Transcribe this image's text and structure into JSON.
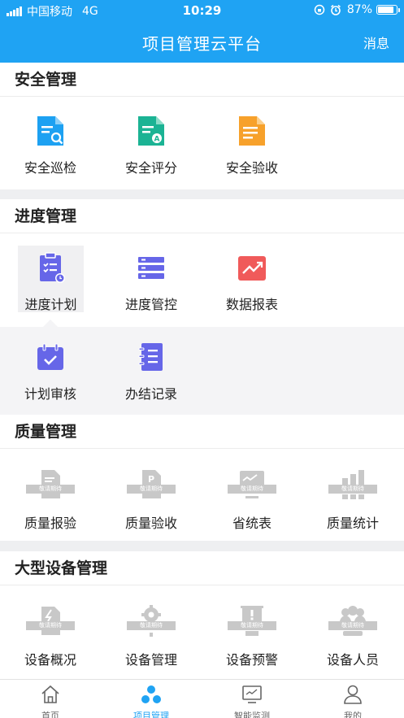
{
  "status_bar": {
    "carrier": "中国移动",
    "network": "4G",
    "time": "10:29",
    "battery": "87%",
    "battery_level": 0.87
  },
  "nav": {
    "title": "项目管理云平台",
    "message": "消息"
  },
  "sections": {
    "safety": {
      "title": "安全管理",
      "items": [
        {
          "label": "安全巡检",
          "icon": "document-search-icon",
          "color": "#1da1f2"
        },
        {
          "label": "安全评分",
          "icon": "document-grade-icon",
          "color": "#1bb394"
        },
        {
          "label": "安全验收",
          "icon": "document-list-icon",
          "color": "#f7a12b"
        }
      ]
    },
    "progress": {
      "title": "进度管理",
      "items": [
        {
          "label": "进度计划",
          "icon": "clipboard-plan-icon",
          "color": "#6666e8"
        },
        {
          "label": "进度管控",
          "icon": "layers-icon",
          "color": "#6666e8"
        },
        {
          "label": "数据报表",
          "icon": "trend-chart-icon",
          "color": "#f05a5a"
        }
      ],
      "sub_items": [
        {
          "label": "计划审核",
          "icon": "calendar-check-icon",
          "color": "#6666e8"
        },
        {
          "label": "办结记录",
          "icon": "notebook-icon",
          "color": "#6666e8"
        }
      ]
    },
    "quality": {
      "title": "质量管理",
      "items": [
        {
          "label": "质量报验",
          "ribbon": "敬请期待",
          "icon": "document-icon"
        },
        {
          "label": "质量验收",
          "ribbon": "敬请期待",
          "icon": "parking-document-icon"
        },
        {
          "label": "省统表",
          "ribbon": "敬请期待",
          "icon": "monitor-chart-icon"
        },
        {
          "label": "质量统计",
          "ribbon": "敬请期待",
          "icon": "bar-chart-icon"
        }
      ]
    },
    "equipment": {
      "title": "大型设备管理",
      "items": [
        {
          "label": "设备概况",
          "ribbon": "敬请期待",
          "icon": "lightning-document-icon"
        },
        {
          "label": "设备管理",
          "ribbon": "敬请期待",
          "icon": "gear-icon"
        },
        {
          "label": "设备预警",
          "ribbon": "敬请期待",
          "icon": "warning-board-icon"
        },
        {
          "label": "设备人员",
          "ribbon": "敬请期待",
          "icon": "people-icon"
        }
      ]
    }
  },
  "tabs": [
    {
      "label": "首页",
      "icon": "home-icon"
    },
    {
      "label": "项目管理",
      "icon": "project-nodes-icon",
      "active": true
    },
    {
      "label": "智能监测",
      "icon": "monitor-icon"
    },
    {
      "label": "我的",
      "icon": "user-icon"
    }
  ],
  "colors": {
    "accent": "#1fa3f3",
    "placeholder": "#c8c8c8"
  }
}
